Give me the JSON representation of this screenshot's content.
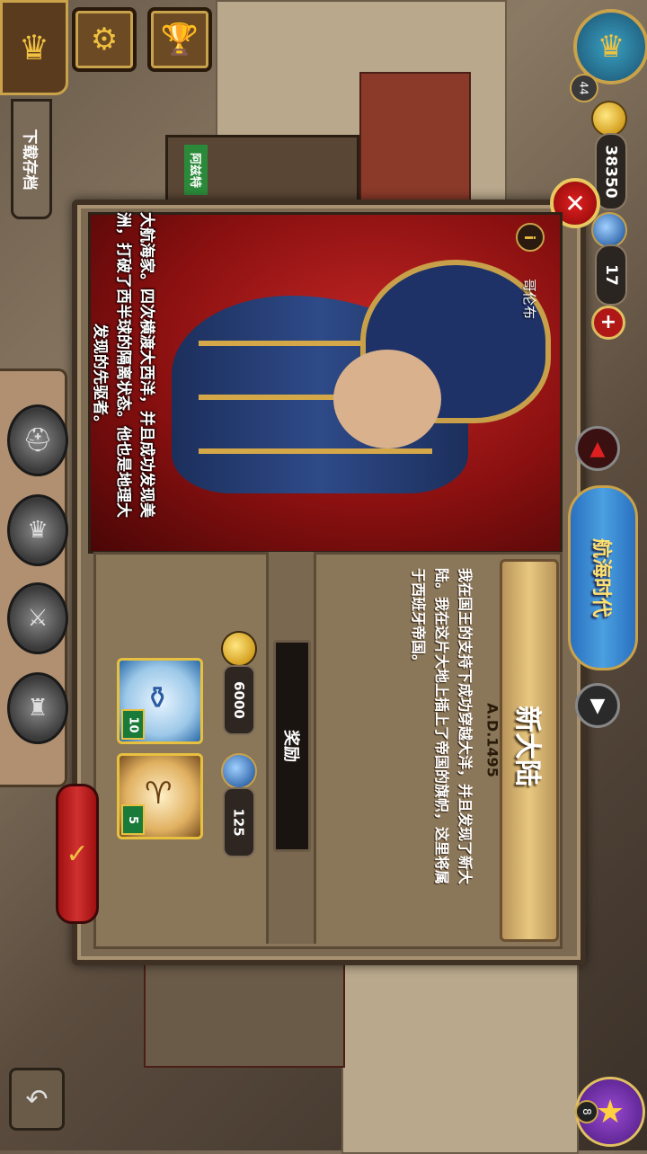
{
  "top_left": {
    "download_label": "下载存档"
  },
  "resources": {
    "coins": "38350",
    "medals": "17",
    "level": "44"
  },
  "top_card": {
    "tag": "阿兹特"
  },
  "hero": {
    "name": "哥伦布",
    "description_lines": [
      "大航海家。四次横渡大西洋，并且成功发现美",
      "洲，打破了西半球的隔离状态。他也是地理大",
      "发现的先驱者。"
    ]
  },
  "era": {
    "title": "新大陆",
    "date": "A.D.1495",
    "story_lines": [
      "我在国王的支持下成功穿越大洋，并且发现了新大",
      "陆。我在这片大地上插上了帝国的旗帜，这里将属",
      "于西班牙帝国。"
    ],
    "age_label": "航海时代"
  },
  "rewards": {
    "banner_label": "奖励",
    "items": [
      {
        "icon": "porcelain-vase-icon",
        "qty": "10",
        "cost": "6000",
        "cost_type": "coin"
      },
      {
        "icon": "horn-icon",
        "qty": "5",
        "cost": "125",
        "cost_type": "medal"
      }
    ]
  },
  "side_menu": {
    "items": [
      "helmet-icon",
      "crown-icon",
      "sword-icon",
      "castle-icon"
    ]
  },
  "star": {
    "count": "8"
  },
  "colors": {
    "panel": "#7d6a52",
    "accent_gold": "#c9a24a",
    "close_red": "#e02020",
    "curtain_red": "#c42626"
  }
}
